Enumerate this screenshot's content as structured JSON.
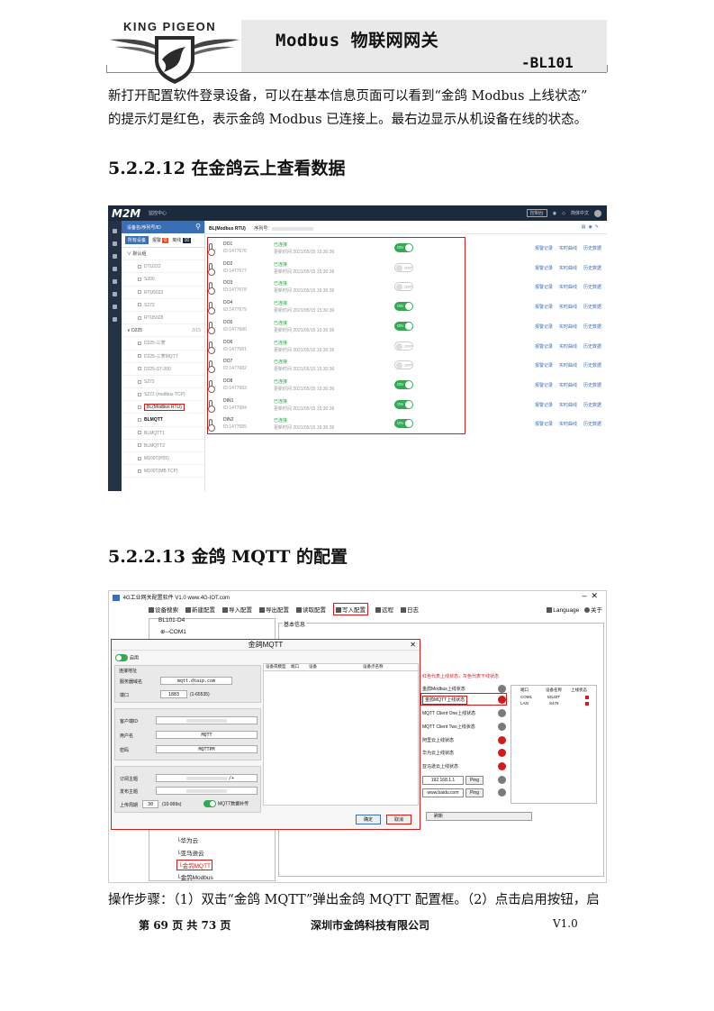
{
  "header": {
    "logo_text": "KING PIGEON",
    "doc_title": "Modbus 物联网网关",
    "model": "-BL101"
  },
  "intro": {
    "line1": "新打开配置软件登录设备，可以在基本信息页面可以看到“金鸽 Modbus 上线状态”",
    "line2": "的提示灯是红色，表示金鸽 Modbus 已连接上。最右边显示从机设备在线的状态。"
  },
  "section_1": {
    "title": "5.2.2.12 在金鸽云上查看数据"
  },
  "m2m": {
    "logo": "M2M",
    "nav": "监控中心",
    "top_right": {
      "button": "控制台",
      "lang": "简体中文"
    },
    "search_placeholder": "设备名/序列号/ID",
    "tabs": {
      "all": "所有设备",
      "alarm": "报警",
      "alarm_count": "0",
      "offline": "离线",
      "offline_count": "10"
    },
    "tree": [
      {
        "label": "默认组",
        "type": "grp",
        "num": ""
      },
      {
        "label": "DTU222",
        "type": "dev",
        "num": ""
      },
      {
        "label": "S200",
        "type": "dev",
        "num": ""
      },
      {
        "label": "RTU5022",
        "type": "dev",
        "num": ""
      },
      {
        "label": "S272",
        "type": "dev",
        "num": ""
      },
      {
        "label": "RTU5028",
        "type": "dev",
        "num": ""
      },
      {
        "label": "D225",
        "type": "grp",
        "num": "2/15"
      },
      {
        "label": "D225-三菱",
        "type": "dev",
        "num": ""
      },
      {
        "label": "D225-三菱MQTT",
        "type": "dev",
        "num": ""
      },
      {
        "label": "D225-S7-200",
        "type": "dev",
        "num": ""
      },
      {
        "label": "S272",
        "type": "dev",
        "num": ""
      },
      {
        "label": "S272 (modbus TCP)",
        "type": "dev",
        "num": ""
      },
      {
        "label": "BL(Modbus RTU)",
        "type": "sel",
        "num": ""
      },
      {
        "label": "BLMQTT",
        "type": "bold",
        "num": ""
      },
      {
        "label": "BLMQTT1",
        "type": "dev",
        "num": ""
      },
      {
        "label": "BLMQTT2",
        "type": "dev",
        "num": ""
      },
      {
        "label": "M100T(P05)",
        "type": "dev",
        "num": ""
      },
      {
        "label": "M100T(MB TCP)",
        "type": "dev",
        "num": ""
      }
    ],
    "main_header": {
      "device": "BL(Modbus RTU)",
      "serial_label": "序列号:"
    },
    "io_rows": [
      {
        "name": "DO1",
        "id": "ID:1477676",
        "status": "已连接",
        "time": "更新时间 2021/05/15 15:30:36",
        "state": "ON"
      },
      {
        "name": "DO2",
        "id": "ID:1477677",
        "status": "已连接",
        "time": "更新时间 2021/05/15 15:30:36",
        "state": "OFF"
      },
      {
        "name": "DO3",
        "id": "ID:1477678",
        "status": "已连接",
        "time": "更新时间 2021/05/15 15:30:36",
        "state": "OFF"
      },
      {
        "name": "DO4",
        "id": "ID:1477679",
        "status": "已连接",
        "time": "更新时间 2021/05/15 15:30:36",
        "state": "ON"
      },
      {
        "name": "DO5",
        "id": "ID:1477680",
        "status": "已连接",
        "time": "更新时间 2021/05/15 15:30:36",
        "state": "ON"
      },
      {
        "name": "DO6",
        "id": "ID:1477681",
        "status": "已连接",
        "time": "更新时间 2021/05/15 15:30:36",
        "state": "OFF"
      },
      {
        "name": "DO7",
        "id": "ID:1477682",
        "status": "已连接",
        "time": "更新时间 2021/05/15 15:30:36",
        "state": "OFF"
      },
      {
        "name": "DO8",
        "id": "ID:1477683",
        "status": "已连接",
        "time": "更新时间 2021/05/15 15:30:36",
        "state": "ON"
      },
      {
        "name": "DIN1",
        "id": "ID:1477684",
        "status": "已连接",
        "time": "更新时间 2021/05/15 15:30:36",
        "state": "ON"
      },
      {
        "name": "DIN2",
        "id": "ID:1477685",
        "status": "已连接",
        "time": "更新时间 2021/05/15 15:30:36",
        "state": "ON"
      }
    ],
    "row_links": {
      "a": "报警记录",
      "b": "实时曲线",
      "c": "历史数据"
    }
  },
  "section_2": {
    "title": "5.2.2.13 金鸽 MQTT 的配置"
  },
  "cfg": {
    "title": "4G工业网关配置软件 V1.0 www.4G-IOT.com",
    "toolbar": [
      "设备搜索",
      "新建配置",
      "导入配置",
      "导出配置",
      "读取配置",
      "写入配置",
      "远程",
      "日志"
    ],
    "lang": "Language",
    "about": "关于",
    "tree": {
      "root": "BL101-D4",
      "com1": "COM1",
      "huawei": "华为云",
      "ali": "亚马逊云",
      "jinge_mqtt": "金鸽MQTT",
      "jinge_modbus": "金鸽Modbus"
    },
    "group_label": "基本信息",
    "legend": "红色代表上线状态，灰色代表下线状态",
    "status_rows": [
      "金鸽Modbus上线状态",
      "金鸽MQTT上线状态",
      "MQTT Client One上线状态",
      "MQTT Client Two上线状态",
      "阿里云上线状态",
      "华为云上线状态",
      "亚马逊云上线状态"
    ],
    "ping": {
      "ip": "192.168.1.1",
      "host": "www.baidu.com",
      "label": "Ping"
    },
    "iface": {
      "h1": "端口",
      "h2": "设备名称",
      "h3": "上线状态",
      "rows": [
        {
          "port": "COM1",
          "dev": "M140T"
        },
        {
          "port": "LAN",
          "dev": "S475"
        }
      ]
    },
    "refresh": "刷新",
    "dialog": {
      "title": "金鸽MQTT",
      "enable": "启用",
      "conn_label": "连接地址",
      "server_label": "服务器域名",
      "server": "mqtt.dtaip.com",
      "port_label": "端口",
      "port": "1883",
      "port_range": "(1-65535)",
      "client_id_label": "客户端ID",
      "user_label": "用户名",
      "user": "MQTT",
      "pass_label": "密码",
      "pass": "MQTTPM",
      "sub_label": "订阅主题",
      "sub_suffix": "/+",
      "pub_label": "发布主题",
      "interval_label": "上传周期",
      "interval": "30",
      "interval_range": "(10-999s)",
      "mqtt_data": "MQTT数据补传",
      "col1": "设备或模型",
      "col2": "端口",
      "col3": "设备",
      "col4": "设备点名称",
      "ok": "确定",
      "cancel": "取消"
    }
  },
  "steps": {
    "line": "操作步骤：（1）双击“金鸽 MQTT”弹出金鸽 MQTT 配置框。（2）点击启用按钮，启"
  },
  "footer": {
    "page_prefix": "第",
    "page": "69",
    "page_mid": "页 共",
    "total": "73",
    "page_suffix": "页",
    "company": "深圳市金鸽科技有限公司",
    "version": "V1.0"
  }
}
